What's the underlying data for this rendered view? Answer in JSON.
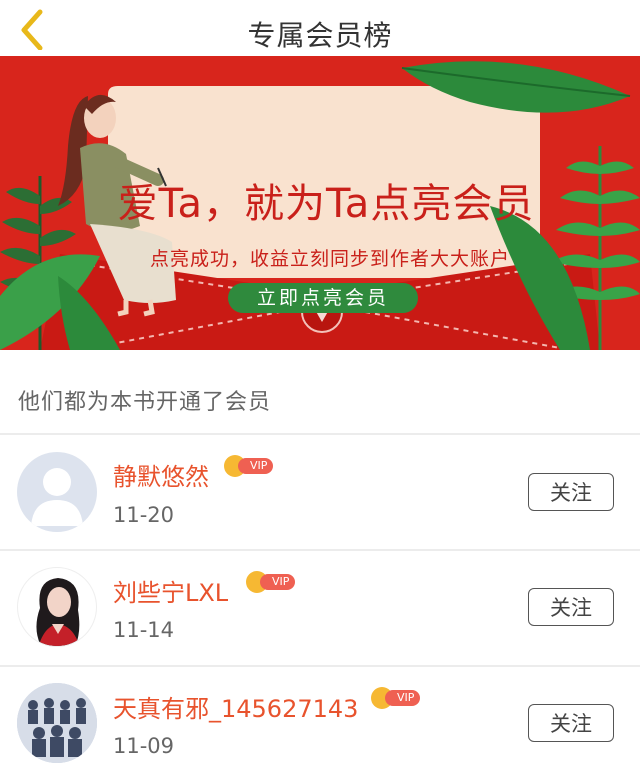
{
  "header": {
    "title": "专属会员榜",
    "back_icon": "chevron-left-icon"
  },
  "banner": {
    "headline": "爱Ta，就为Ta点亮会员",
    "subtitle": "点亮成功，收益立刻同步到作者大大账户",
    "cta_label": "立即点亮会员",
    "colors": {
      "background": "#d8251c",
      "card": "#f9e2cf",
      "button": "#2f8a3d",
      "text": "#c9201a"
    }
  },
  "section": {
    "title": "他们都为本书开通了会员"
  },
  "members": [
    {
      "name": "静默悠然",
      "date": "11-20",
      "badge": "VIP",
      "follow_label": "关注",
      "avatar": "default-avatar"
    },
    {
      "name": "刘些宁LXL",
      "date": "11-14",
      "badge": "VIP",
      "follow_label": "关注",
      "avatar": "photo-avatar"
    },
    {
      "name": "天真有邪_145627143",
      "date": "11-09",
      "badge": "VIP",
      "follow_label": "关注",
      "avatar": "group-photo-avatar"
    }
  ]
}
